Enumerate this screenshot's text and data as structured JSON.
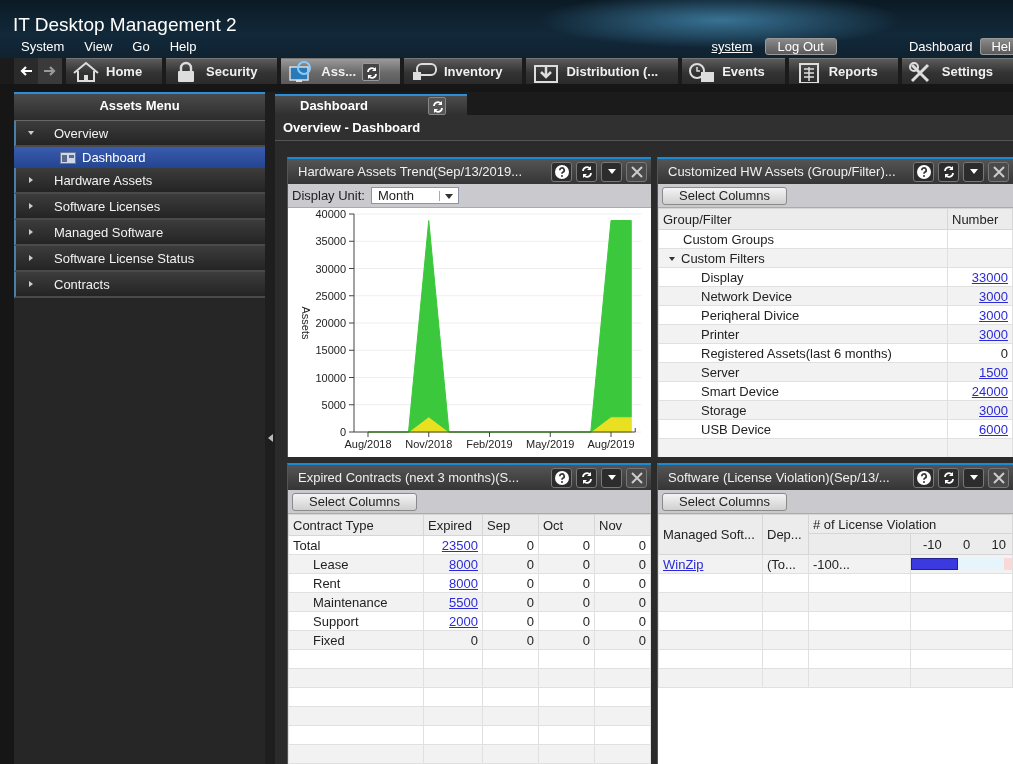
{
  "window": {
    "title": "IT Desktop Management 2"
  },
  "menu_bar": [
    "System",
    "View",
    "Go",
    "Help"
  ],
  "header_right": {
    "user": "system",
    "logout": "Log Out",
    "page": "Dashboard",
    "help": "Hel"
  },
  "nav_tabs": [
    {
      "label": "Home",
      "selected": false,
      "refresh": false
    },
    {
      "label": "Security",
      "selected": false,
      "refresh": false
    },
    {
      "label": "Ass...",
      "selected": true,
      "refresh": true
    },
    {
      "label": "Inventory",
      "selected": false,
      "refresh": false
    },
    {
      "label": "Distribution (...",
      "selected": false,
      "refresh": false
    },
    {
      "label": "Events",
      "selected": false,
      "refresh": false
    },
    {
      "label": "Reports",
      "selected": false,
      "refresh": false
    },
    {
      "label": "Settings",
      "selected": false,
      "refresh": false
    }
  ],
  "sidebar": {
    "title": "Assets Menu",
    "items": [
      {
        "label": "Overview",
        "expanded": true,
        "selected": false,
        "children": [
          {
            "label": "Dashboard",
            "selected": true
          }
        ]
      },
      {
        "label": "Hardware Assets",
        "expanded": false,
        "selected": false
      },
      {
        "label": "Software Licenses",
        "expanded": false,
        "selected": false
      },
      {
        "label": "Managed Software",
        "expanded": false,
        "selected": false
      },
      {
        "label": "Software License Status",
        "expanded": false,
        "selected": false
      },
      {
        "label": "Contracts",
        "expanded": false,
        "selected": false
      }
    ]
  },
  "main": {
    "tab": {
      "label": "Dashboard",
      "selected": true
    },
    "breadcrumb": "Overview - Dashboard"
  },
  "portlets": [
    {
      "kind": "chart",
      "title": "Hardware Assets Trend(Sep/13/2019...",
      "display_unit_label": "Display Unit:",
      "display_unit": "Month",
      "chart_data": {
        "type": "area",
        "stacked": true,
        "grid": true,
        "ylabel": "Assets",
        "categories": [
          "Aug/2018",
          null,
          null,
          "Nov/2018",
          null,
          null,
          "Feb/2019",
          null,
          null,
          "May/2019",
          null,
          null,
          "Aug/2019",
          null
        ],
        "ylim": [
          0,
          40000
        ],
        "yticks": [
          0,
          5000,
          10000,
          15000,
          20000,
          25000,
          30000,
          35000,
          40000
        ],
        "series": [
          {
            "color": "#e8e020",
            "values": [
              0,
              0,
              0,
              2800,
              0,
              0,
              0,
              0,
              0,
              0,
              0,
              0,
              2800,
              2800
            ]
          },
          {
            "color": "#3cc83c",
            "values": [
              0,
              0,
              0,
              36000,
              0,
              0,
              0,
              0,
              0,
              0,
              0,
              0,
              36000,
              36000
            ]
          }
        ]
      }
    },
    {
      "kind": "tree-table",
      "title": "Customized HW Assets (Group/Filter)...",
      "toolbar_button": "Select Columns",
      "columns": [
        "Group/Filter",
        "Number"
      ],
      "rows": [
        {
          "label": "Custom Groups"
        },
        {
          "label": "Custom Filters",
          "expanded": true,
          "children": [
            {
              "label": "Display",
              "number": "33000",
              "linked": true
            },
            {
              "label": "Network Device",
              "number": "3000",
              "linked": true
            },
            {
              "label": "Periqheral Divice",
              "number": "3000",
              "linked": true
            },
            {
              "label": "Printer",
              "number": "3000",
              "linked": true
            },
            {
              "label": "Registered Assets(last 6 months)",
              "number": "0",
              "linked": false
            },
            {
              "label": "Server",
              "number": "1500",
              "linked": true
            },
            {
              "label": "Smart Device",
              "number": "24000",
              "linked": true
            },
            {
              "label": "Storage",
              "number": "3000",
              "linked": true
            },
            {
              "label": "USB Device",
              "number": "6000",
              "linked": true
            }
          ]
        }
      ]
    },
    {
      "kind": "grid",
      "title": "Expired Contracts (next 3 months)(S...",
      "toolbar_button": "Select Columns",
      "columns": [
        "Contract Type",
        "Expired",
        "Sep",
        "Oct",
        "Nov"
      ],
      "rows": [
        {
          "cells": [
            "Total",
            "23500",
            "0",
            "0",
            "0"
          ],
          "linked": true,
          "children": [
            {
              "cells": [
                "Lease",
                "8000",
                "0",
                "0",
                "0"
              ],
              "linked": true
            },
            {
              "cells": [
                "Rent",
                "8000",
                "0",
                "0",
                "0"
              ],
              "linked": true
            },
            {
              "cells": [
                "Maintenance",
                "5500",
                "0",
                "0",
                "0"
              ],
              "linked": true
            },
            {
              "cells": [
                "Support",
                "2000",
                "0",
                "0",
                "0"
              ],
              "linked": true
            },
            {
              "cells": [
                "Fixed",
                "0",
                "0",
                "0",
                "0"
              ],
              "linked": false
            }
          ]
        }
      ]
    },
    {
      "kind": "violation",
      "title": "Software (License Violation)(Sep/13/...",
      "toolbar_button": "Select Columns",
      "columns": [
        "Managed Soft...",
        "Dep..."
      ],
      "group_header": "# of License Violation",
      "axis_ticks": [
        "-10",
        "0",
        "10"
      ],
      "rows": [
        {
          "software": "WinZip",
          "department": "(To...",
          "count": "-100...",
          "level": 0.47
        }
      ]
    }
  ]
}
